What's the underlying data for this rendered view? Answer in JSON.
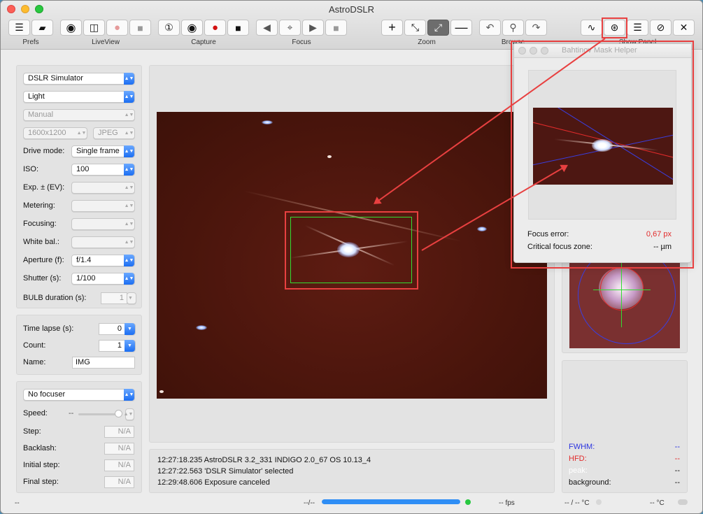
{
  "window": {
    "title": "AstroDSLR"
  },
  "toolbar": {
    "groups": [
      "Prefs",
      "LiveView",
      "Capture",
      "Focus",
      "Zoom",
      "Browse",
      "Show Panel"
    ]
  },
  "left": {
    "camera_select": "DSLR Simulator",
    "frame_type": "Light",
    "mode": "Manual",
    "resolution": "1600x1200",
    "format": "JPEG",
    "rows": [
      {
        "label": "Drive mode:",
        "value": "Single frame"
      },
      {
        "label": "ISO:",
        "value": "100"
      },
      {
        "label": "Exp. ± (EV):",
        "value": ""
      },
      {
        "label": "Metering:",
        "value": ""
      },
      {
        "label": "Focusing:",
        "value": ""
      },
      {
        "label": "White bal.:",
        "value": ""
      },
      {
        "label": "Aperture (f):",
        "value": "f/1.4"
      },
      {
        "label": "Shutter (s):",
        "value": "1/100"
      }
    ],
    "bulb": {
      "label": "BULB duration (s):",
      "value": "1"
    },
    "timelapse": {
      "label": "Time lapse (s):",
      "value": "0"
    },
    "count": {
      "label": "Count:",
      "value": "1"
    },
    "name": {
      "label": "Name:",
      "value": "IMG"
    },
    "focuser_select": "No focuser",
    "speed": {
      "label": "Speed:",
      "value": "--"
    },
    "focuser_rows": [
      {
        "label": "Step:",
        "value": "N/A"
      },
      {
        "label": "Backlash:",
        "value": "N/A"
      },
      {
        "label": "Initial step:",
        "value": "N/A"
      },
      {
        "label": "Final step:",
        "value": "N/A"
      }
    ]
  },
  "log": [
    "12:27:18.235 AstroDSLR 3.2_331 INDIGO 2.0_67 OS 10.13_4",
    "12:27:22.563 'DSLR Simulator' selected",
    "12:29:48.606 Exposure canceled"
  ],
  "stats": [
    {
      "label": "FWHM:",
      "value": "--",
      "color": "#2b34e0"
    },
    {
      "label": "HFD:",
      "value": "--",
      "color": "#e22b2b"
    },
    {
      "label": "peak:",
      "value": "--",
      "color": "#ffffff"
    },
    {
      "label": "background:",
      "value": "--",
      "color": "#111111"
    }
  ],
  "bahtinov": {
    "title": "Bahtinov Mask Helper",
    "focus_error_label": "Focus error:",
    "focus_error_value": "0,67 px",
    "critical_label": "Critical focus zone:",
    "critical_value": "-- µm"
  },
  "statusbar": {
    "left": "--",
    "progress_label": "--/--",
    "progress_fraction": 1.0,
    "fps": "-- fps",
    "temp": "-- / -- °C",
    "cooler": "-- °C"
  },
  "colors": {
    "annotation": "#e84040",
    "accent": "#1c6ef2",
    "focus_error": "#e22b2b"
  }
}
